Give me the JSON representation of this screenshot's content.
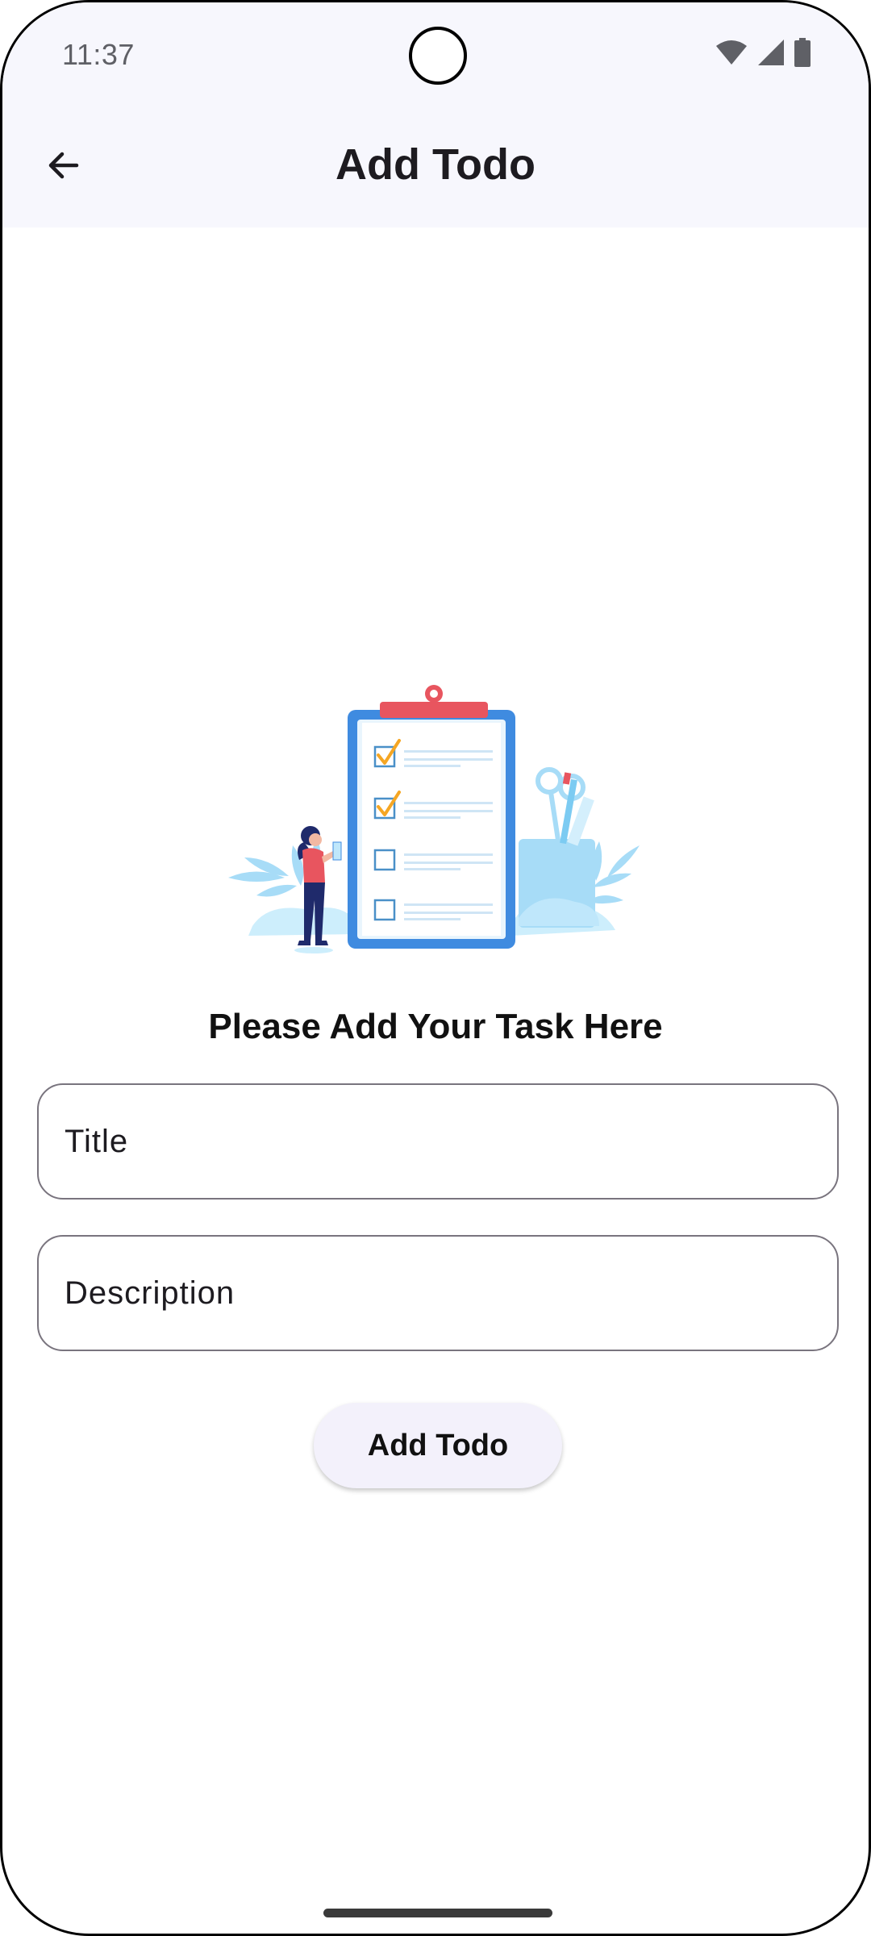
{
  "status_bar": {
    "time": "11:37",
    "icons": [
      "wifi-icon",
      "signal-icon",
      "battery-icon"
    ]
  },
  "app_bar": {
    "back_icon": "arrow-back-icon",
    "title": "Add Todo"
  },
  "illustration": {
    "icon": "clipboard-checklist-illustration",
    "items_checked": [
      true,
      true,
      false,
      false
    ]
  },
  "form": {
    "prompt": "Please Add Your Task Here",
    "title_field": {
      "placeholder": "Title",
      "value": ""
    },
    "description_field": {
      "placeholder": "Description",
      "value": ""
    },
    "submit_label": "Add Todo"
  },
  "colors": {
    "app_bar_bg": "#f7f7fd",
    "button_bg": "#f3f1fb",
    "clipboard_blue": "#3f8be0",
    "clip_red": "#e8555f",
    "check_orange": "#f5a623",
    "leaf_blue": "#a7dcf7"
  }
}
